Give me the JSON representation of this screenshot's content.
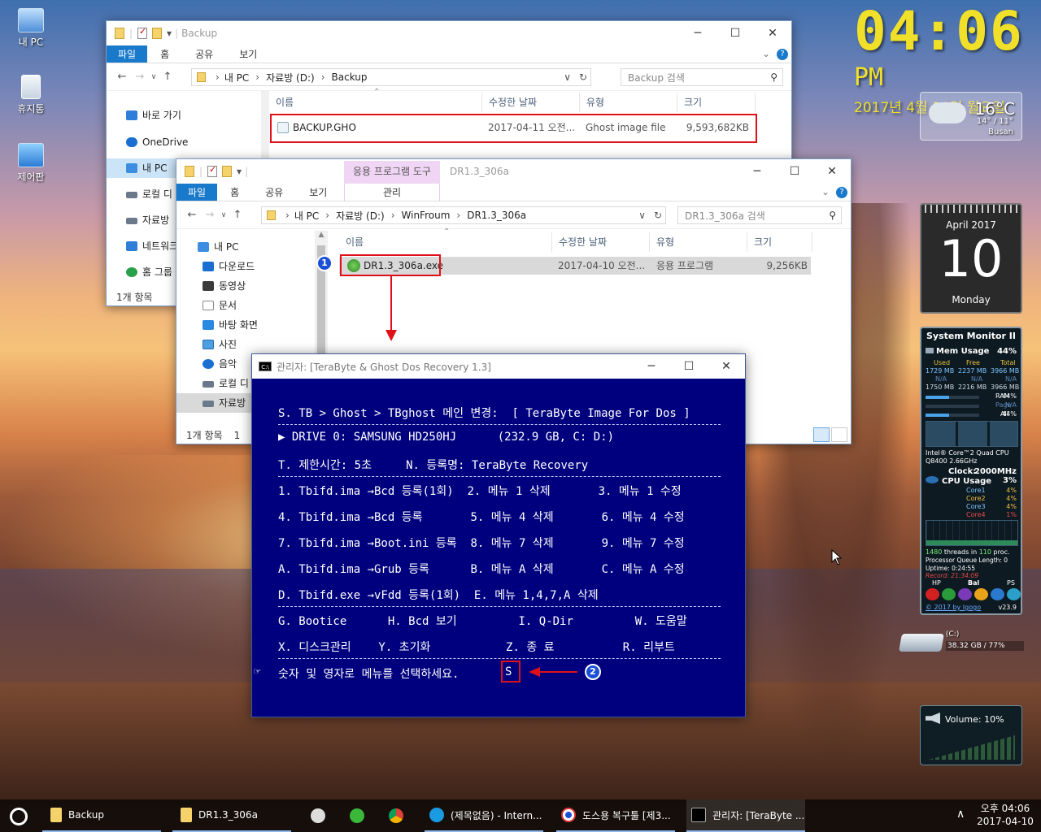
{
  "desktop": {
    "icons": [
      "내 PC",
      "휴지통",
      "제어판"
    ]
  },
  "clock_gadget": {
    "time": "04:06",
    "ampm": "PM",
    "date": "2017년 4월 10일 월요일"
  },
  "weather_gadget": {
    "temp": "16°C",
    "range": "14° / 11°",
    "city": "Busan"
  },
  "calendar_gadget": {
    "month_year": "April 2017",
    "day": "10",
    "weekday": "Monday"
  },
  "system_monitor": {
    "title": "System Monitor II",
    "mem_label": "Mem Usage",
    "mem_pct": "44%",
    "hdr": [
      "Used",
      "Free",
      "Total"
    ],
    "row1": [
      "1729 MB",
      "2237 MB",
      "3966 MB"
    ],
    "row2": [
      "N/A",
      "N/A",
      "N/A"
    ],
    "row3": [
      "1750 MB",
      "2216 MB",
      "3966 MB"
    ],
    "ram_label": "RAM",
    "ram_pct": "44%",
    "ram_fill": 0.44,
    "page_label": "Page",
    "page_pct": "N/A",
    "all_label": "All",
    "all_pct": "44%",
    "all_fill": 0.44,
    "cpu_name": "Intel® Core™2 Quad CPU",
    "cpu_model": "Q8400 2.66GHz",
    "clock_label": "Clock:",
    "clock_val": "2000MHz",
    "cpu_label": "CPU Usage",
    "cpu_pct": "3%",
    "cores": [
      {
        "name": "Core1",
        "pct": "4%"
      },
      {
        "name": "Core2",
        "pct": "4%"
      },
      {
        "name": "Core3",
        "pct": "4%"
      },
      {
        "name": "Core4",
        "pct": "1%"
      }
    ],
    "threads": "1480",
    "threads_mid": "threads in",
    "procs": "110",
    "procs_suffix": "proc.",
    "queue": "Processor Queue Length: 0",
    "uptime": "Uptime: 0:24:55",
    "record": "Record: 21:34:09",
    "power": [
      "HP",
      "Bal",
      "PS"
    ],
    "copyright": "© 2017 by Igogo",
    "version": "v23.9"
  },
  "drive_gadget": {
    "label": "(C:)",
    "info": "38.32 GB / 77%"
  },
  "volume_gadget": {
    "label": "Volume: 10%"
  },
  "win_backup": {
    "title": "Backup",
    "tabs": [
      "파일",
      "홈",
      "공유",
      "보기"
    ],
    "path": [
      "내 PC",
      "자료방 (D:)",
      "Backup"
    ],
    "search": "Backup 검색",
    "nav": [
      "바로 가기",
      "OneDrive",
      "내 PC",
      "로컬 디",
      "자료방",
      "네트워크",
      "홈 그룹"
    ],
    "columns": [
      "이름",
      "수정한 날짜",
      "유형",
      "크기"
    ],
    "file": {
      "name": "BACKUP.GHO",
      "date": "2017-04-11 오전...",
      "type": "Ghost image file",
      "size": "9,593,682KB"
    },
    "status": "1개 항목"
  },
  "win_dr": {
    "title": "DR1.3_306a",
    "context_tab": "응용 프로그램 도구",
    "context_sub": "관리",
    "tabs": [
      "파일",
      "홈",
      "공유",
      "보기"
    ],
    "path": [
      "내 PC",
      "자료방 (D:)",
      "WinFroum",
      "DR1.3_306a"
    ],
    "search": "DR1.3_306a 검색",
    "nav": [
      "내 PC",
      "다운로드",
      "동영상",
      "문서",
      "바탕 화면",
      "사진",
      "음악",
      "로컬 디",
      "자료방"
    ],
    "columns": [
      "이름",
      "수정한 날짜",
      "유형",
      "크기"
    ],
    "file": {
      "name": "DR1.3_306a.exe",
      "date": "2017-04-10 오전...",
      "type": "응용 프로그램",
      "size": "9,256KB"
    },
    "status": "1개 항목",
    "status2": "1"
  },
  "cmd": {
    "title": "관리자:  [TeraByte & Ghost Dos Recovery 1.3]",
    "lines": [
      "S. TB > Ghost > TBghost 메인 변경:  [ TeraByte Image For Dos ]",
      "▶ DRIVE 0: SAMSUNG HD250HJ      (232.9 GB, C: D:)",
      "T. 제한시간: 5초     N. 등록명: TeraByte Recovery",
      "1. Tbifd.ima →Bcd 등록(1회)  2. 메뉴 1 삭제       3. 메뉴 1 수정",
      "4. Tbifd.ima →Bcd 등록       5. 메뉴 4 삭제       6. 메뉴 4 수정",
      "7. Tbifd.ima →Boot.ini 등록  8. 메뉴 7 삭제       9. 메뉴 7 수정",
      "A. Tbifd.ima →Grub 등록      B. 메뉴 A 삭제       C. 메뉴 A 수정",
      "D. Tbifd.exe →vFdd 등록(1회)  E. 메뉴 1,4,7,A 삭제",
      "G. Bootice      H. Bcd 보기         I. Q-Dir         W. 도움말",
      "X. 디스크관리    Y. 초기화           Z. 종 료          R. 리부트"
    ],
    "prompt": "숫자 및 영자로 메뉴를 선택하세요.",
    "input": "S",
    "marker": "☞"
  },
  "badges": [
    "1",
    "2"
  ],
  "taskbar": {
    "items": [
      {
        "label": "Backup"
      },
      {
        "label": "DR1.3_306a"
      },
      {
        "label": "(제목없음) - Intern..."
      },
      {
        "label": "도스용 복구툴 [제3..."
      },
      {
        "label": "관리자:  [TeraByte ..."
      }
    ],
    "time": "오후 04:06",
    "date": "2017-04-10"
  }
}
